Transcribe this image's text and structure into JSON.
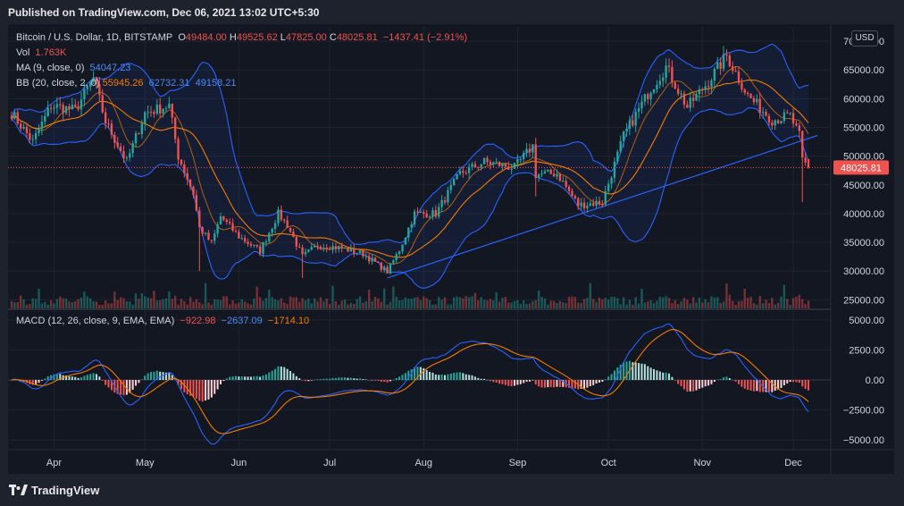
{
  "header": {
    "published": "Published on TradingView.com, Dec 06, 2021 13:02 UTC+5:30"
  },
  "footer": {
    "brand": "TradingView"
  },
  "currency_button": "USD",
  "colors": {
    "up": "#26a69a",
    "down": "#ef5350",
    "bb": "#2962ff",
    "ma": "#f57c00",
    "background": "#131722"
  },
  "legend": {
    "symbol": "Bitcoin / U.S. Dollar, 1D, BITSTAMP",
    "open_label": "O",
    "open": "49484.00",
    "high_label": "H",
    "high": "49525.62",
    "low_label": "L",
    "low": "47825.00",
    "close_label": "C",
    "close": "48025.81",
    "change": "−1437.41 (−2.91%)",
    "vol_label": "Vol",
    "vol": "1.763K",
    "ma_label": "MA (9, close, 0)",
    "ma": "54047.23",
    "bb_label": "BB (20, close, 2, 0)",
    "bb_basis": "55945.26",
    "bb_upper": "62732.31",
    "bb_lower": "49158.21",
    "macd_label": "MACD (12, 26, close, 9, EMA, EMA)",
    "macd_hist": "−922.98",
    "macd_line": "−2637.09",
    "macd_signal": "−1714.10"
  },
  "price_tag": "48025.81",
  "chart_data": [
    {
      "type": "candlestick",
      "title": "Bitcoin / U.S. Dollar, 1D, BITSTAMP",
      "y_ticks": [
        "70000.00",
        "65000.00",
        "60000.00",
        "55000.00",
        "50000.00",
        "45000.00",
        "40000.00",
        "35000.00",
        "30000.00",
        "25000.00"
      ],
      "x_ticks": [
        "Apr",
        "May",
        "Jun",
        "Jul",
        "Aug",
        "Sep",
        "Oct",
        "Nov",
        "Dec"
      ],
      "ylim": [
        23500,
        72500
      ],
      "x_start": "2021-03-18",
      "x_end": "2021-12-06",
      "anchors": [
        [
          "2021-03-18",
          57500
        ],
        [
          "2021-03-25",
          52500
        ],
        [
          "2021-03-31",
          58800
        ],
        [
          "2021-04-08",
          58000
        ],
        [
          "2021-04-14",
          63500
        ],
        [
          "2021-04-18",
          56000
        ],
        [
          "2021-04-25",
          49000
        ],
        [
          "2021-05-01",
          57500
        ],
        [
          "2021-05-09",
          58800
        ],
        [
          "2021-05-12",
          50000
        ],
        [
          "2021-05-17",
          43500
        ],
        [
          "2021-05-19",
          37500
        ],
        [
          "2021-05-23",
          34800
        ],
        [
          "2021-05-26",
          39500
        ],
        [
          "2021-06-01",
          36000
        ],
        [
          "2021-06-08",
          33500
        ],
        [
          "2021-06-14",
          40000
        ],
        [
          "2021-06-17",
          38000
        ],
        [
          "2021-06-22",
          32500
        ],
        [
          "2021-06-27",
          34500
        ],
        [
          "2021-07-05",
          34000
        ],
        [
          "2021-07-12",
          33000
        ],
        [
          "2021-07-20",
          29900
        ],
        [
          "2021-07-24",
          33700
        ],
        [
          "2021-07-29",
          40000
        ],
        [
          "2021-08-05",
          40000
        ],
        [
          "2021-08-13",
          47000
        ],
        [
          "2021-08-21",
          49000
        ],
        [
          "2021-08-31",
          48000
        ],
        [
          "2021-09-06",
          51800
        ],
        [
          "2021-09-07",
          46800
        ],
        [
          "2021-09-14",
          47000
        ],
        [
          "2021-09-21",
          41500
        ],
        [
          "2021-09-29",
          42000
        ],
        [
          "2021-10-06",
          53500
        ],
        [
          "2021-10-15",
          61800
        ],
        [
          "2021-10-20",
          65500
        ],
        [
          "2021-10-27",
          58500
        ],
        [
          "2021-11-03",
          63000
        ],
        [
          "2021-11-09",
          67500
        ],
        [
          "2021-11-16",
          60500
        ],
        [
          "2021-11-24",
          56300
        ],
        [
          "2021-11-30",
          57000
        ],
        [
          "2021-12-03",
          53500
        ],
        [
          "2021-12-04",
          49200
        ],
        [
          "2021-12-06",
          48025
        ]
      ],
      "price_label": 48025.81,
      "trendline": [
        [
          "2021-07-20",
          28800
        ],
        [
          "2021-12-09",
          53600
        ]
      ],
      "series": [
        {
          "name": "MA (9, close, 0)",
          "last": 54047.23
        },
        {
          "name": "BB (20, close, 2, 0)",
          "basis": 55945.26,
          "upper": 62732.31,
          "lower": 49158.21
        }
      ]
    },
    {
      "type": "bar",
      "title": "Vol",
      "last": "1.763K"
    },
    {
      "type": "line",
      "title": "MACD (12, 26, close, 9, EMA, EMA)",
      "y_ticks": [
        "5000.00",
        "2500.00",
        "0.00",
        "−2500.00",
        "−5000.00"
      ],
      "ylim": [
        -5800,
        5800
      ],
      "series": [
        {
          "name": "Histogram",
          "last": -922.98
        },
        {
          "name": "MACD",
          "last": -2637.09
        },
        {
          "name": "Signal",
          "last": -1714.1
        }
      ]
    }
  ]
}
